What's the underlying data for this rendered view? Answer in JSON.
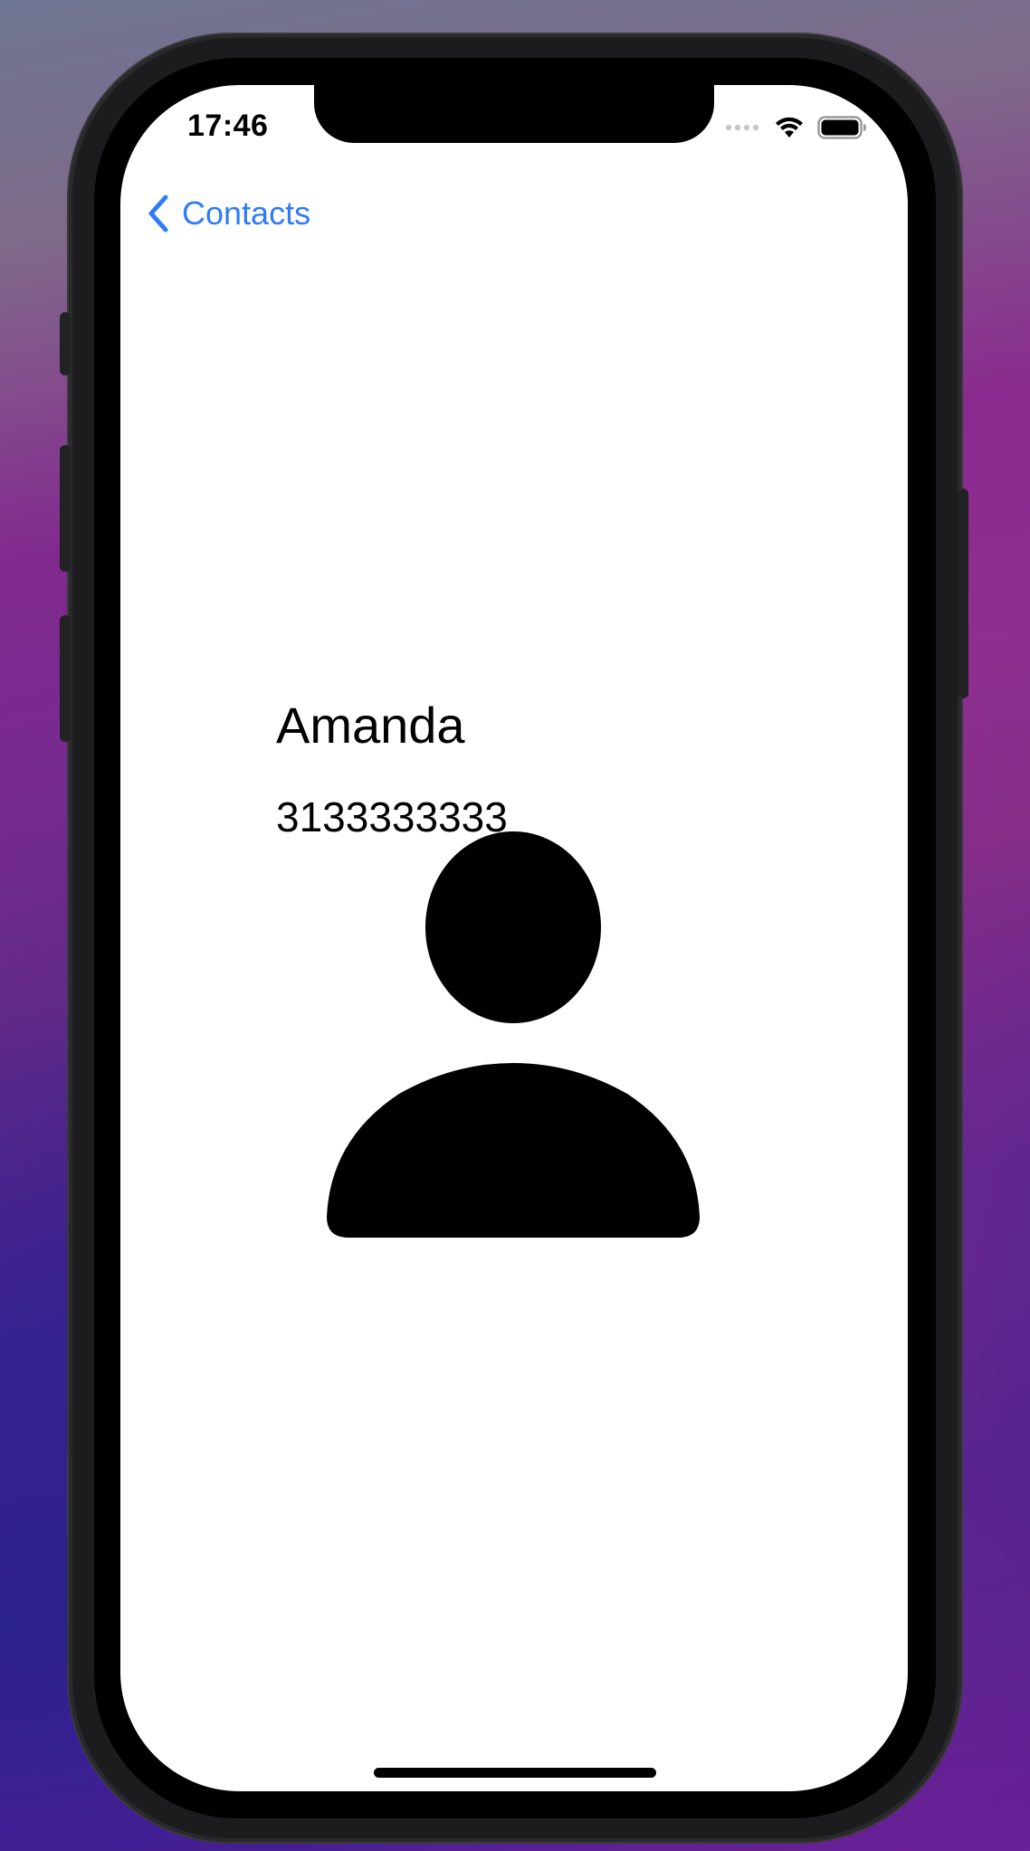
{
  "status_bar": {
    "time": "17:46",
    "icons": [
      "cellular-signal-icon",
      "wifi-icon",
      "battery-icon"
    ]
  },
  "navigation": {
    "back_label": "Contacts",
    "back_icon": "chevron-left-icon",
    "accent_color": "#2f7cf6"
  },
  "contact": {
    "name": "Amanda",
    "phone": "3133333333",
    "avatar_icon": "person-silhouette-icon"
  }
}
